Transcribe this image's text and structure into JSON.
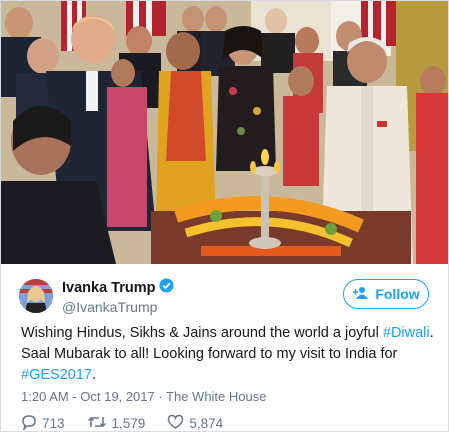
{
  "header": {
    "display_name": "Ivanka Trump",
    "handle": "@IvankaTrump",
    "follow_label": "Follow"
  },
  "tweet": {
    "text_1": "Wishing Hindus, Sikhs & Jains around the world a joyful ",
    "hashtag_1": "#Diwali",
    "text_2": ". Saal Mubarak to all! Looking forward to my visit to India for ",
    "hashtag_2": "#GES2017",
    "text_3": "."
  },
  "meta": {
    "timestamp": "1:20 AM - Oct 19, 2017",
    "separator": " · ",
    "location": "The White House"
  },
  "actions": {
    "replies": "713",
    "retweets": "1,579",
    "likes": "5,874"
  },
  "colors": {
    "link": "#1da1f2",
    "text": "#14171a",
    "muted": "#657786"
  },
  "icons": [
    "verified-badge-icon",
    "follow-person-icon",
    "reply-icon",
    "retweet-icon",
    "like-icon"
  ]
}
